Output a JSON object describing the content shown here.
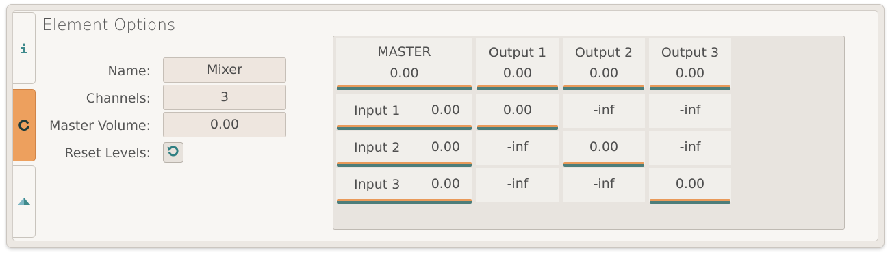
{
  "title": "Element Options",
  "tabs": [
    {
      "name": "info",
      "icon": "info-icon",
      "active": false
    },
    {
      "name": "mixer",
      "icon": "refresh-icon",
      "active": true
    },
    {
      "name": "shape",
      "icon": "triangle-icon",
      "active": false
    }
  ],
  "form": {
    "name_label": "Name:",
    "name_value": "Mixer",
    "channels_label": "Channels:",
    "channels_value": "3",
    "master_volume_label": "Master Volume:",
    "master_volume_value": "0.00",
    "reset_label": "Reset Levels:",
    "reset_icon": "reset-icon"
  },
  "matrix": {
    "headers": [
      {
        "name": "MASTER",
        "value": "0.00"
      },
      {
        "name": "Output 1",
        "value": "0.00"
      },
      {
        "name": "Output 2",
        "value": "0.00"
      },
      {
        "name": "Output 3",
        "value": "0.00"
      }
    ],
    "rows": [
      {
        "name": "Input 1",
        "value": "0.00",
        "cells": [
          "0.00",
          "-inf",
          "-inf"
        ]
      },
      {
        "name": "Input 2",
        "value": "0.00",
        "cells": [
          "-inf",
          "0.00",
          "-inf"
        ]
      },
      {
        "name": "Input 3",
        "value": "0.00",
        "cells": [
          "-inf",
          "-inf",
          "0.00"
        ]
      }
    ]
  },
  "colors": {
    "accent": "#eda05e",
    "teal": "#4c7d7a",
    "icon_teal": "#3f8a8c"
  }
}
